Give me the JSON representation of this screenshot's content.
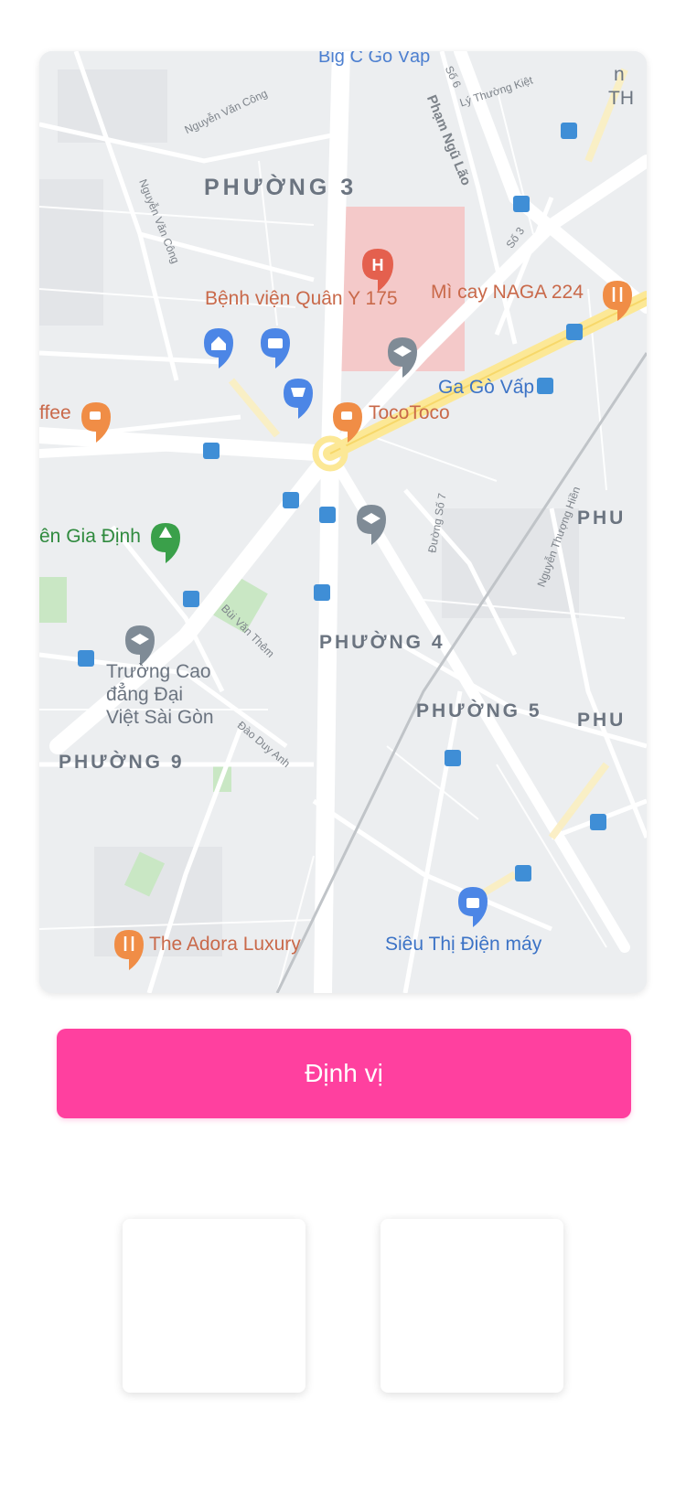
{
  "map": {
    "labels": {
      "big_c": "Big C Gò Vấp",
      "nguyen_van_cong_1": "Nguyễn Văn Công",
      "pham_ngu_lao": "Phạm Ngũ Lão",
      "so6": "Số 6",
      "ly_thuong_kiet": "Lý Thường Kiệt",
      "th": "TH",
      "n_edge": "n",
      "phuong3": "PHƯỜNG 3",
      "nguyen_van_cong_2": "Nguyễn Văn Công",
      "so3": "Số 3",
      "benh_vien": "Bệnh viện Quân Y 175",
      "mi_cay": "Mì cay NAGA 224",
      "ga_go_vap": "Ga Gò Vấp",
      "coffee": "ffee",
      "tocotoco": "TocoToco",
      "duong_so7": "Đường Số 7",
      "nguyen_thuong_hien": "Nguyễn Thượng Hiền",
      "phu_right_1": "PHU",
      "gia_dinh": "ên Gia Định",
      "bui_van_them": "Bùi Văn Thêm",
      "phuong4": "PHƯỜNG 4",
      "truong_cao_dang": [
        "Trường Cao",
        "đẳng Đại",
        "Việt Sài Gòn"
      ],
      "phuong5": "PHƯỜNG 5",
      "phu_right_2": "PHU",
      "dao_duy_anh": "Đào Duy Anh",
      "phuong9": "PHƯỜNG 9",
      "adora": "The Adora Luxury",
      "sieu_thi": "Siêu Thị Điện máy"
    },
    "colors": {
      "background": "#eceef0",
      "road": "#ffffff",
      "major_road": "#fce896",
      "hospital_area": "#f4c9c9",
      "park": "#c9e7c4",
      "red_pin": "#e4604e",
      "orange_pin": "#f08d46",
      "blue_pin": "#4c86e6",
      "gray_pin": "#7f8b96",
      "green_pin": "#3aa04a",
      "transit": "#3f8ed6"
    }
  },
  "locate_button": {
    "label": "Định vị",
    "color": "#ff409f"
  },
  "thumbnails": [
    "empty",
    "empty"
  ]
}
